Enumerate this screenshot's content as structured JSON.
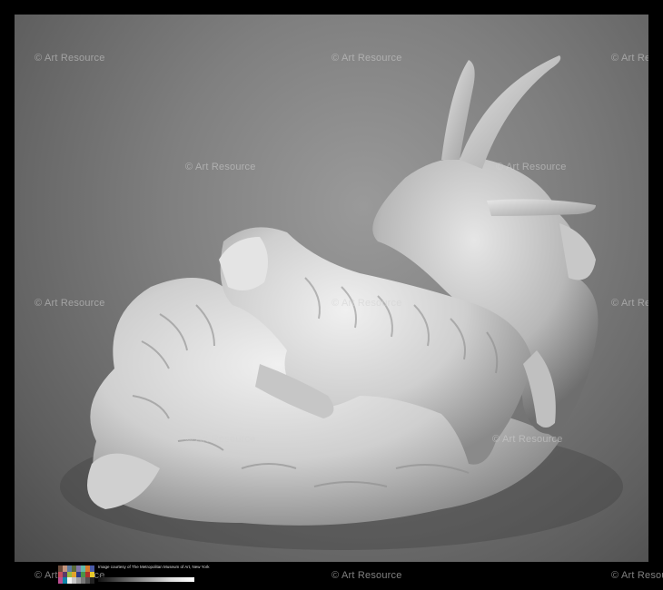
{
  "watermark": "© Art Resource",
  "credit_line": "Image courtesy of The Metropolitan Museum of Art, New York",
  "colors": {
    "frame": "#000000",
    "background": "#7f7f7f",
    "sculpture": "#d8d8d8",
    "shadow": "#3c3c3c"
  },
  "color_checker": [
    "#6b4b3a",
    "#c4957c",
    "#5d7aa0",
    "#5b6b3a",
    "#8276a8",
    "#62b9a8",
    "#d77a2b",
    "#4a5aa6",
    "#c24e5a",
    "#5a3a6a",
    "#9bbb3e",
    "#e1a42b",
    "#2c3a8a",
    "#4a9448",
    "#b0302c",
    "#e8c82a",
    "#bb4e92",
    "#0e86a8",
    "#f2f2f2",
    "#c8c8c8",
    "#a0a0a0",
    "#787878",
    "#505050",
    "#222222"
  ]
}
